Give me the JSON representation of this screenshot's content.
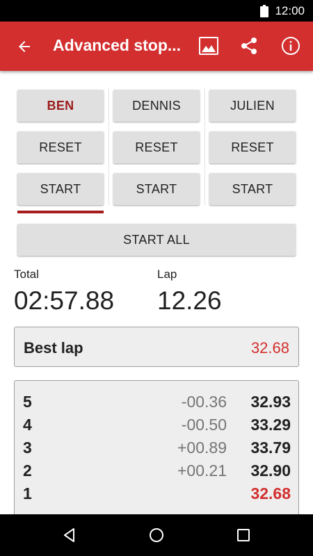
{
  "status_bar": {
    "time": "12:00",
    "battery_icon": "battery-full-icon"
  },
  "app_bar": {
    "title": "Advanced stop...",
    "back_icon": "arrow-back-icon",
    "actions": [
      "image-icon",
      "share-icon",
      "info-icon"
    ],
    "color": "#d32f2f"
  },
  "players": [
    {
      "name": "BEN",
      "reset_label": "RESET",
      "start_label": "START",
      "selected": true
    },
    {
      "name": "DENNIS",
      "reset_label": "RESET",
      "start_label": "START",
      "selected": false
    },
    {
      "name": "JULIEN",
      "reset_label": "RESET",
      "start_label": "START",
      "selected": false
    }
  ],
  "start_all_label": "START ALL",
  "total": {
    "label": "Total",
    "value": "02:57.88"
  },
  "lap": {
    "label": "Lap",
    "value": "12.26"
  },
  "best_lap": {
    "label": "Best lap",
    "value": "32.68"
  },
  "laps": [
    {
      "number": "5",
      "diff": "-00.36",
      "time": "32.93",
      "best": false
    },
    {
      "number": "4",
      "diff": "-00.50",
      "time": "33.29",
      "best": false
    },
    {
      "number": "3",
      "diff": "+00.89",
      "time": "33.79",
      "best": false
    },
    {
      "number": "2",
      "diff": "+00.21",
      "time": "32.90",
      "best": false
    },
    {
      "number": "1",
      "diff": "",
      "time": "32.68",
      "best": true
    }
  ],
  "colors": {
    "accent": "#d32f2f",
    "selected_text": "#9b1c1c",
    "indicator": "#a61c1c"
  },
  "nav_bar": {
    "icons": [
      "nav-back-icon",
      "nav-home-icon",
      "nav-recents-icon"
    ]
  }
}
